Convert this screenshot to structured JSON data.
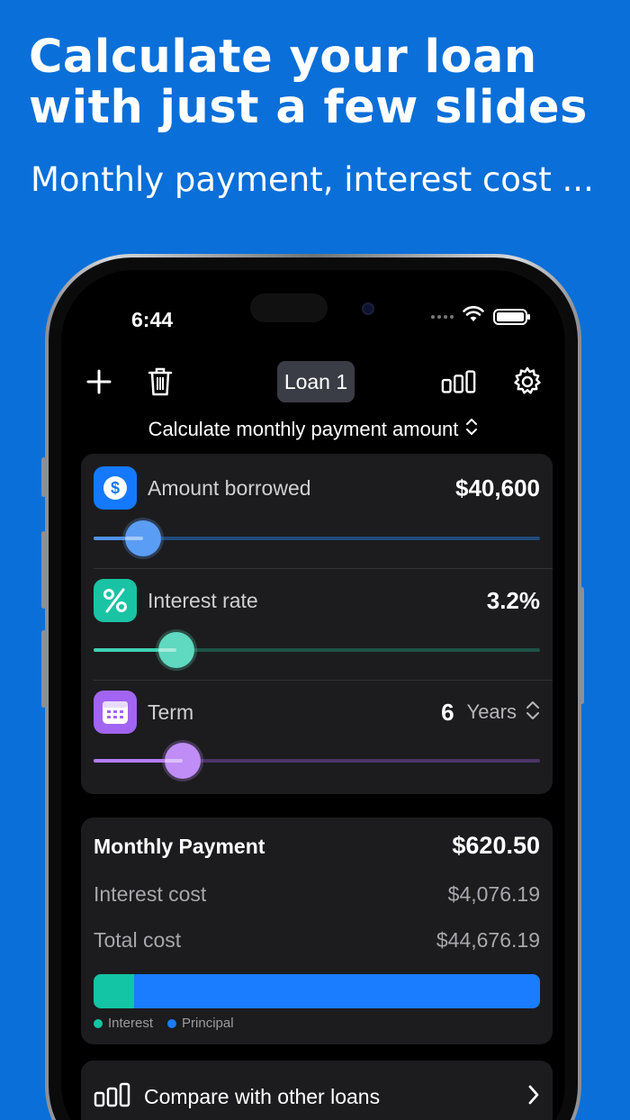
{
  "marketing": {
    "headline_line1": "Calculate your loan",
    "headline_line2": "with just a few slides",
    "subline": "Monthly payment, interest cost ..."
  },
  "status_bar": {
    "time": "6:44"
  },
  "toolbar": {
    "add_icon": "plus-icon",
    "delete_icon": "trash-icon",
    "loan_name": "Loan 1",
    "compare_icon": "bars-icon",
    "settings_icon": "gear-icon"
  },
  "mode": {
    "label": "Calculate monthly payment amount",
    "icon": "chevron-up-down-icon"
  },
  "inputs": {
    "amount": {
      "label": "Amount borrowed",
      "value": "$40,600",
      "slider_fraction": 0.11,
      "color": "#1479ff",
      "icon": "dollar-icon"
    },
    "rate": {
      "label": "Interest rate",
      "value": "3.2%",
      "slider_fraction": 0.185,
      "color": "#19c3a4",
      "icon": "percent-icon"
    },
    "term": {
      "label": "Term",
      "value": "6",
      "unit": "Years",
      "slider_fraction": 0.2,
      "color": "#a264f2",
      "icon": "calendar-icon"
    }
  },
  "summary": {
    "monthly_label": "Monthly Payment",
    "monthly_value": "$620.50",
    "interest_label": "Interest cost",
    "interest_value": "$4,076.19",
    "total_label": "Total cost",
    "total_value": "$44,676.19",
    "interest_share": 0.0912,
    "interest_color": "#13c5a5",
    "principal_color": "#1a7cff",
    "legend_interest": "Interest",
    "legend_principal": "Principal"
  },
  "compare": {
    "label": "Compare with other loans",
    "icon": "bars-icon"
  }
}
